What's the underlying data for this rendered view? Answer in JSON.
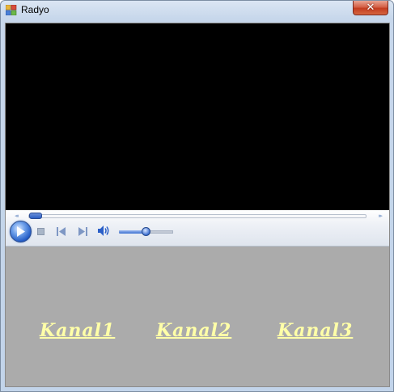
{
  "window": {
    "title": "Radyo",
    "close_label": "✕"
  },
  "player": {
    "state": "stopped",
    "seek_position": 0.0,
    "volume": 0.5,
    "seek_back_glyph": "◂◂",
    "seek_forward_glyph": "▸▸"
  },
  "channels": [
    {
      "label": "Kanal1"
    },
    {
      "label": "Kanal2"
    },
    {
      "label": "Kanal3"
    }
  ],
  "colors": {
    "link": "#ffffa8",
    "client_background": "#ababab",
    "video_background": "#000000"
  }
}
